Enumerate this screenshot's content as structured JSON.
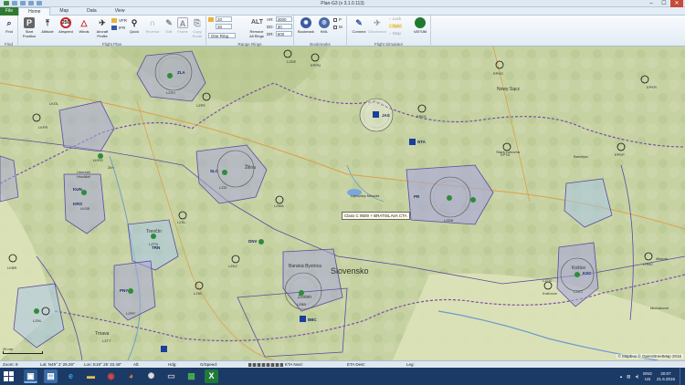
{
  "app": {
    "title": "Plan-G3 (v 3.1.0.113)",
    "winbtns": [
      "–",
      "☐",
      "✕"
    ]
  },
  "tabs": [
    {
      "label": "File"
    },
    {
      "label": "Home"
    },
    {
      "label": "Map"
    },
    {
      "label": "Data"
    },
    {
      "label": "View"
    }
  ],
  "ribbon": {
    "groups": {
      "find": "Find",
      "flight_plan": "Flight Plan",
      "range_rings": "Range Rings",
      "bookmarks": "Bookmarks",
      "flight_simulator": "Flight Simulator"
    },
    "buttons": {
      "find": "Find",
      "start_position": "Start Position",
      "altitude": "Altitude",
      "airspeed": "Airspeed",
      "winds": "Winds",
      "aircraft_profile": "Aircraft Profile",
      "vfr": "VFR",
      "ifr": "IFR",
      "quick": "Quick",
      "reverse": "Reverse",
      "edit": "Edit",
      "frame": "Frame",
      "copy_route": "Copy Route",
      "alt": "ALT",
      "remove_all_rings": "Remove All Rings",
      "bookmark": "Bookmark",
      "kml": "KML",
      "connect": "Connect",
      "disconnect": "Disconnect",
      "sync": "Sync",
      "vatsim": "VATSIM"
    },
    "rings": {
      "values": [
        "20",
        "30"
      ],
      "select": "One Ring",
      "alt_rows": [
        {
          "label": "AR:",
          "value": "3000"
        },
        {
          "label": "DD:",
          "value": "30"
        },
        {
          "label": "DR:",
          "value": "600"
        }
      ]
    },
    "checks": [
      "P",
      "M"
    ],
    "sim_small": [
      "Lock",
      "Sync",
      "Stop"
    ]
  },
  "map": {
    "country": "Slovensko",
    "cities": [
      {
        "name": "Nowy Sącz"
      },
      {
        "name": "Žilina"
      },
      {
        "name": "Trenčín"
      },
      {
        "name": "Banská Bystrica"
      },
      {
        "name": "Zvolen"
      },
      {
        "name": "Košice"
      },
      {
        "name": "Trnava"
      },
      {
        "name": "Liptovský Mikuláš"
      },
      {
        "name": "Stará Ľubovňa"
      },
      {
        "name": "Bardejov"
      },
      {
        "name": "Uherské Hradiště"
      },
      {
        "name": "Zlín"
      },
      {
        "name": "Miskolc"
      },
      {
        "name": "Kráľovce"
      },
      {
        "name": "Michalovce"
      }
    ],
    "airspace_labels": [
      {
        "id": "JAS"
      },
      {
        "id": "NTA"
      },
      {
        "id": "SLC"
      },
      {
        "id": "PR"
      },
      {
        "id": "BBC"
      },
      {
        "id": "KSC"
      },
      {
        "id": "PNY"
      },
      {
        "id": "TRN"
      },
      {
        "id": "KUN"
      },
      {
        "id": "KRO"
      },
      {
        "id": "ZLA"
      },
      {
        "id": "DNV"
      }
    ],
    "airport_codes": [
      "EPNS",
      "EPKR",
      "LKOL",
      "LKFR",
      "LKRG",
      "LZZI",
      "LZTN",
      "LZPP",
      "LZMA",
      "LZSL",
      "LZKZ",
      "LZNI",
      "EPPN",
      "EPKS",
      "LKSB",
      "LKBR",
      "LZSV",
      "LZPE",
      "LZDE",
      "LZBB",
      "LZDB",
      "LZKC",
      "EPKP",
      "EPTA",
      "LHMC",
      "LZHL",
      "LZOC",
      "LZTT"
    ],
    "tooltip": "Class C 9500 + BRATISLAVA CTA",
    "attribution": "© Mapbox © OpenStreetMap 2016",
    "scale": "20 nm"
  },
  "status": {
    "zoom": "Zoom: 9",
    "lat": "Lat: N49° 2' 29.29\"",
    "lon": "Lon: E19° 25' 33.48\"",
    "alt": "Alt:",
    "hdg": "Hdg:",
    "gspeed": "G/Speed:",
    "eta_next": "ETA Next:",
    "eta_dest": "ETA Dest:",
    "leg": "Leg:"
  },
  "taskbar": {
    "apps": [
      {
        "name": "plang"
      },
      {
        "name": "save"
      },
      {
        "name": "ie"
      },
      {
        "name": "explorer"
      },
      {
        "name": "chrome"
      },
      {
        "name": "firefox"
      },
      {
        "name": "settings"
      },
      {
        "name": "cmd"
      },
      {
        "name": "photos"
      },
      {
        "name": "excel"
      }
    ],
    "lang": "ENG",
    "lang2": "US",
    "time": "20:07",
    "date": "21.6.2016"
  }
}
